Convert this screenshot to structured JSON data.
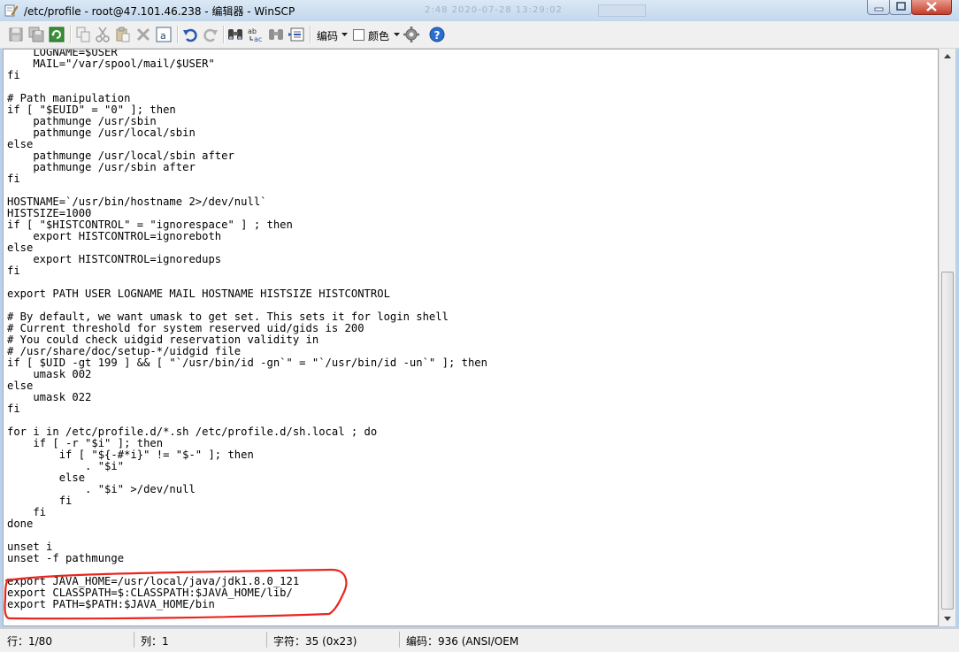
{
  "window": {
    "title": "/etc/profile - root@47.101.46.238 - 编辑器 - WinSCP",
    "ghost_text": "2:48   2020-07-28 13:29:02"
  },
  "toolbar": {
    "encoding_label": "编码",
    "color_label": "颜色",
    "icons": [
      "save-icon",
      "save-all-icon",
      "refresh-icon",
      "copy-icon",
      "cut-icon",
      "paste-icon",
      "delete-icon",
      "select-all-icon",
      "undo-icon",
      "redo-icon",
      "find-icon",
      "replace-icon",
      "find-next-icon",
      "goto-line-icon",
      "encoding-icon",
      "settings-icon",
      "help-icon"
    ]
  },
  "editor": {
    "content": "    LOGNAME=$USER\n    MAIL=\"/var/spool/mail/$USER\"\nfi\n\n# Path manipulation\nif [ \"$EUID\" = \"0\" ]; then\n    pathmunge /usr/sbin\n    pathmunge /usr/local/sbin\nelse\n    pathmunge /usr/local/sbin after\n    pathmunge /usr/sbin after\nfi\n\nHOSTNAME=`/usr/bin/hostname 2>/dev/null`\nHISTSIZE=1000\nif [ \"$HISTCONTROL\" = \"ignorespace\" ] ; then\n    export HISTCONTROL=ignoreboth\nelse\n    export HISTCONTROL=ignoredups\nfi\n\nexport PATH USER LOGNAME MAIL HOSTNAME HISTSIZE HISTCONTROL\n\n# By default, we want umask to get set. This sets it for login shell\n# Current threshold for system reserved uid/gids is 200\n# You could check uidgid reservation validity in\n# /usr/share/doc/setup-*/uidgid file\nif [ $UID -gt 199 ] && [ \"`/usr/bin/id -gn`\" = \"`/usr/bin/id -un`\" ]; then\n    umask 002\nelse\n    umask 022\nfi\n\nfor i in /etc/profile.d/*.sh /etc/profile.d/sh.local ; do\n    if [ -r \"$i\" ]; then\n        if [ \"${-#*i}\" != \"$-\" ]; then\n            . \"$i\"\n        else\n            . \"$i\" >/dev/null\n        fi\n    fi\ndone\n\nunset i\nunset -f pathmunge\n\nexport JAVA_HOME=/usr/local/java/jdk1.8.0_121\nexport CLASSPATH=$:CLASSPATH:$JAVA_HOME/lib/\nexport PATH=$PATH:$JAVA_HOME/bin"
  },
  "statusbar": {
    "line": "行：1/80",
    "column": "列：1",
    "character": "字符：35 (0x23)",
    "encoding": "编码：936   (ANSI/OEM"
  },
  "colors": {
    "annotation": "#e8261e",
    "titlebar": "#c3d7ec"
  }
}
